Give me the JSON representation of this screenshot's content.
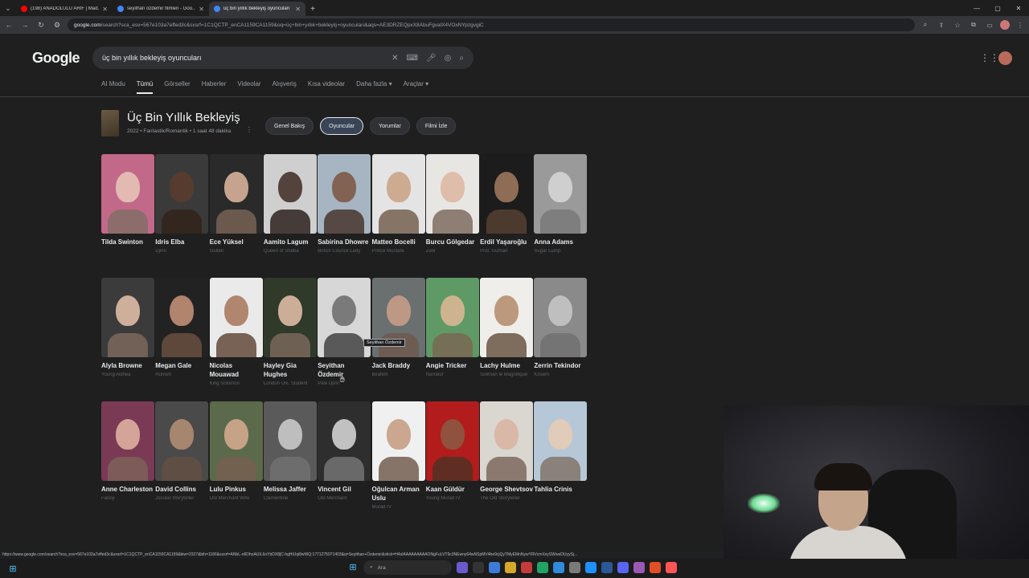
{
  "browser": {
    "tabs": [
      {
        "title": "(198) ANADOLULU ARİF | Mad...",
        "color": "#ff0000",
        "active": false
      },
      {
        "title": "seyithan özdemir filmleri - Goo...",
        "color": "#4285f4",
        "active": false
      },
      {
        "title": "üç bin yıllık bekleyiş oyuncuları",
        "color": "#4285f4",
        "active": true
      }
    ],
    "url_host": "google.com",
    "url_rest": "/search?sca_esv=567e103a7effed3c&sxsrf=1C1QCTP_enCA1159CA1159&oq=üç+bin+yıllık+bekleyiş+oyuncuları&aqs=AE3DRZEQpxX8AbuFgvalX4VOxNYpzgvgiC",
    "status_url": "https://www.google.com/search?sca_esv=567e103a7effed3c&sxsrf=1C1QCTP_enCA1159CA1159&biw=2327&bih=1186&sxsrf=ANbL-n6DhoAUIL6oYbDX8jC-hgHiUqi8wWQ:1771275971403&q=Seyithan+Özdemir&stick=H4sIAAAAAAAAAONgFuLVT9c3NEwny64wNSpMV4be9cjQyTMyEMnNywYRVcmXxySWweDUyySj..."
  },
  "google": {
    "logo": "Google",
    "query": "üç bin yıllık bekleyiş oyuncuları",
    "filters": [
      "AI Modu",
      "Tümü",
      "Görseller",
      "Haberler",
      "Videolar",
      "Alışveriş",
      "Kısa videolar",
      "Daha fazla ▾",
      "Araçlar ▾"
    ],
    "active_filter": "Tümü"
  },
  "entity": {
    "title": "Üç Bin Yıllık Bekleyiş",
    "subtitle": "2022 • Fantastik/Romantik • 1 saat 48 dakika",
    "chips": [
      "Genel Bakış",
      "Oyuncular",
      "Yorumlar",
      "Filmi İzle"
    ],
    "active_chip": "Oyuncular"
  },
  "cast": [
    {
      "name": "Tilda Swinton",
      "role": "",
      "face": "#e8c9b8",
      "bg": "#c2698a"
    },
    {
      "name": "Idris Elba",
      "role": "Djinn",
      "face": "#5a3d2e",
      "bg": "#3a3a3a"
    },
    {
      "name": "Ece Yüksel",
      "role": "Gulten",
      "face": "#e2b9a0",
      "bg": "#2a2a2a"
    },
    {
      "name": "Aamito Lagum",
      "role": "Queen of Sheba",
      "face": "#3d2a22",
      "bg": "#cfcfcf"
    },
    {
      "name": "Sabirina Dhowre",
      "role": "British Council Lady",
      "face": "#7a5440",
      "bg": "#a7b5c2"
    },
    {
      "name": "Matteo Bocelli",
      "role": "Prince Mustafa",
      "face": "#c9a183",
      "bg": "#e4e4e4"
    },
    {
      "name": "Burcu Gölgedar",
      "role": "Zefir",
      "face": "#dcb6a0",
      "bg": "#e8e6e3"
    },
    {
      "name": "Erdil Yaşaroğlu",
      "role": "Prof. Gürhan",
      "face": "#a37a60",
      "bg": "#1c1c1c"
    },
    {
      "name": "Anna Adams",
      "role": "Sugar Lump",
      "face": "#d8d8d8",
      "bg": "#9a9a9a"
    },
    {
      "name": "Alyla Browne",
      "role": "Young Alithea",
      "face": "#e9c4ad",
      "bg": "#3b3b3b"
    },
    {
      "name": "Megan Gale",
      "role": "Hürrem",
      "face": "#c9957a",
      "bg": "#222"
    },
    {
      "name": "Nicolas Mouawad",
      "role": "King Solomon",
      "face": "#a67458",
      "bg": "#eaeaea"
    },
    {
      "name": "Hayley Gia Hughes",
      "role": "London Uni. Student",
      "face": "#e7c3ab",
      "bg": "#2f3a2a"
    },
    {
      "name": "Seyithan Özdemir",
      "role": "Pale Djinn",
      "face": "#6a6a6a",
      "bg": "#d7d7d7"
    },
    {
      "name": "Jack Braddy",
      "role": "Ibrahim",
      "face": "#caa088",
      "bg": "#6a6f70"
    },
    {
      "name": "Angie Tricker",
      "role": "Narrator",
      "face": "#e0b896",
      "bg": "#5f9a66"
    },
    {
      "name": "Lachy Hulme",
      "role": "Soliman le Magnifique",
      "face": "#b38869",
      "bg": "#f0eeea"
    },
    {
      "name": "Zerrin Tekindor",
      "role": "Kösem",
      "face": "#c8c8c8",
      "bg": "#8a8a8a"
    },
    {
      "name": "Anne Charleston",
      "role": "Fanny",
      "face": "#e3b7a3",
      "bg": "#7a3a55"
    },
    {
      "name": "David Collins",
      "role": "Jocular Storyteller",
      "face": "#b79077",
      "bg": "#4a4a4a"
    },
    {
      "name": "Lulu Pinkus",
      "role": "Old Merchant Wife",
      "face": "#d9ad90",
      "bg": "#5b6a4a"
    },
    {
      "name": "Melissa Jaffer",
      "role": "Clementine",
      "face": "#d0d0d0",
      "bg": "#5a5a5a"
    },
    {
      "name": "Vincent Gil",
      "role": "Old Merchant",
      "face": "#dadada",
      "bg": "#2e2e2e"
    },
    {
      "name": "Oğulcan Arman Uslu",
      "role": "Murad IV",
      "face": "#c39a7d",
      "bg": "#f0f0f0"
    },
    {
      "name": "Kaan Güldür",
      "role": "Young Murad IV",
      "face": "#8a5a44",
      "bg": "#b21c1c"
    },
    {
      "name": "George Shevtsov",
      "role": "The Old Storyteller",
      "face": "#d8b3a0",
      "bg": "#dad6d0"
    },
    {
      "name": "Tahlia Crinis",
      "role": "",
      "face": "#e9cbb4",
      "bg": "#b6c7d8"
    }
  ],
  "tooltip": "Seyithan Özdemir",
  "taskbar": {
    "search_label": "Ara",
    "apps": [
      "#6a5acd",
      "#333",
      "#3c7bd9",
      "#d7a72a",
      "#c53b3b",
      "#21a366",
      "#2e8cdb",
      "#7a7a7a",
      "#1e90ff",
      "#2b5797",
      "#5865f2",
      "#9b59b6",
      "#e44d26",
      "#ff5555"
    ]
  }
}
